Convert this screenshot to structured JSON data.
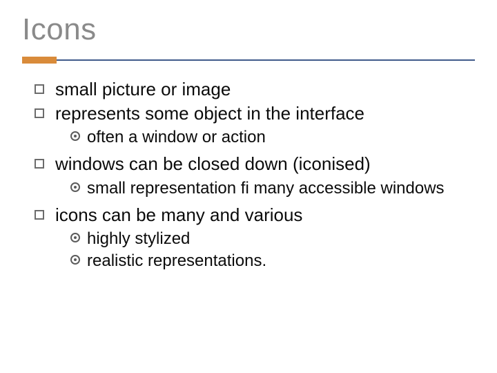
{
  "title": "Icons",
  "bullets": {
    "b1": "small picture or image",
    "b2": "represents some object in the interface",
    "b2_sub1": "often a window or action",
    "b3": "windows can be closed down (iconised)",
    "b3_sub1": "small representation fi many accessible windows",
    "b4": "icons can be many and various",
    "b4_sub1": "highly stylized",
    "b4_sub2": "realistic representations."
  }
}
